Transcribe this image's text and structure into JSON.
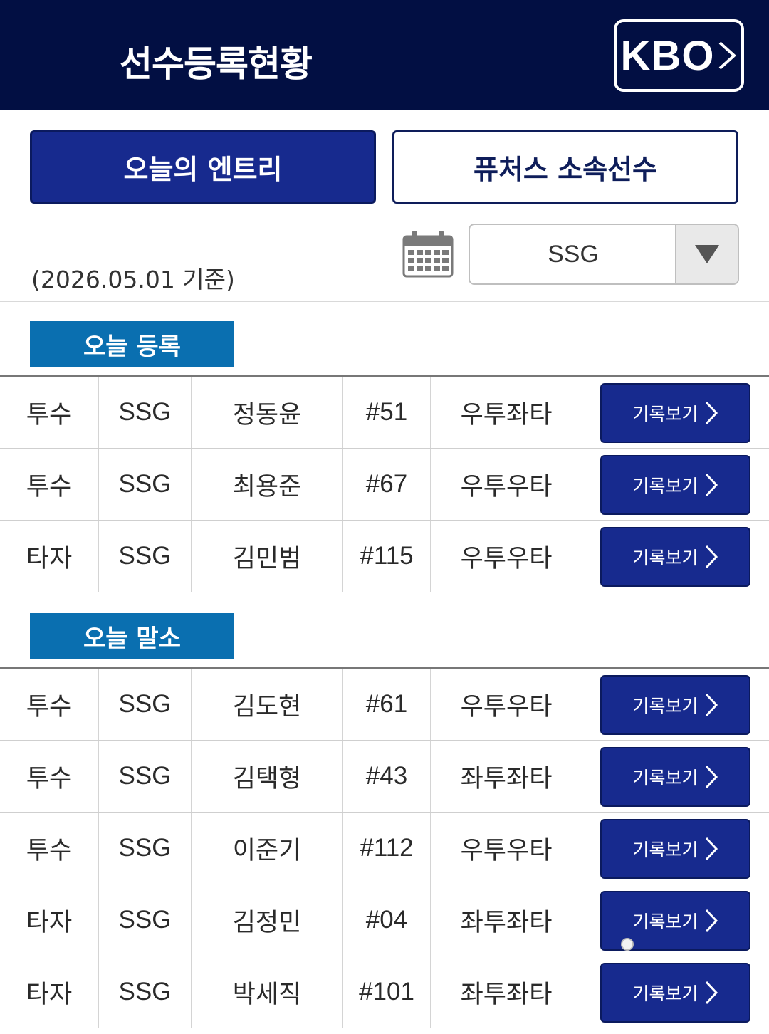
{
  "header": {
    "title": "선수등록현황",
    "kbo_label": "KBO"
  },
  "tabs": [
    {
      "label": "오늘의 엔트리",
      "active": true
    },
    {
      "label": "퓨처스 소속선수",
      "active": false
    }
  ],
  "filter": {
    "date_label": "(2026.05.01 기준)",
    "team": "SSG"
  },
  "colors": {
    "header_bg": "#020f43",
    "button_bg": "#172a8e",
    "badge_bg": "#0a6fb0"
  },
  "button_label": "기록보기",
  "registered": {
    "title": "오늘 등록",
    "rows": [
      {
        "position": "투수",
        "team": "SSG",
        "name": "정동윤",
        "number": "#51",
        "hand": "우투좌타"
      },
      {
        "position": "투수",
        "team": "SSG",
        "name": "최용준",
        "number": "#67",
        "hand": "우투우타"
      },
      {
        "position": "타자",
        "team": "SSG",
        "name": "김민범",
        "number": "#115",
        "hand": "우투우타"
      }
    ]
  },
  "removed": {
    "title": "오늘 말소",
    "rows": [
      {
        "position": "투수",
        "team": "SSG",
        "name": "김도현",
        "number": "#61",
        "hand": "우투우타"
      },
      {
        "position": "투수",
        "team": "SSG",
        "name": "김택형",
        "number": "#43",
        "hand": "좌투좌타"
      },
      {
        "position": "투수",
        "team": "SSG",
        "name": "이준기",
        "number": "#112",
        "hand": "우투우타"
      },
      {
        "position": "타자",
        "team": "SSG",
        "name": "김정민",
        "number": "#04",
        "hand": "좌투좌타"
      },
      {
        "position": "타자",
        "team": "SSG",
        "name": "박세직",
        "number": "#101",
        "hand": "좌투좌타"
      }
    ]
  }
}
